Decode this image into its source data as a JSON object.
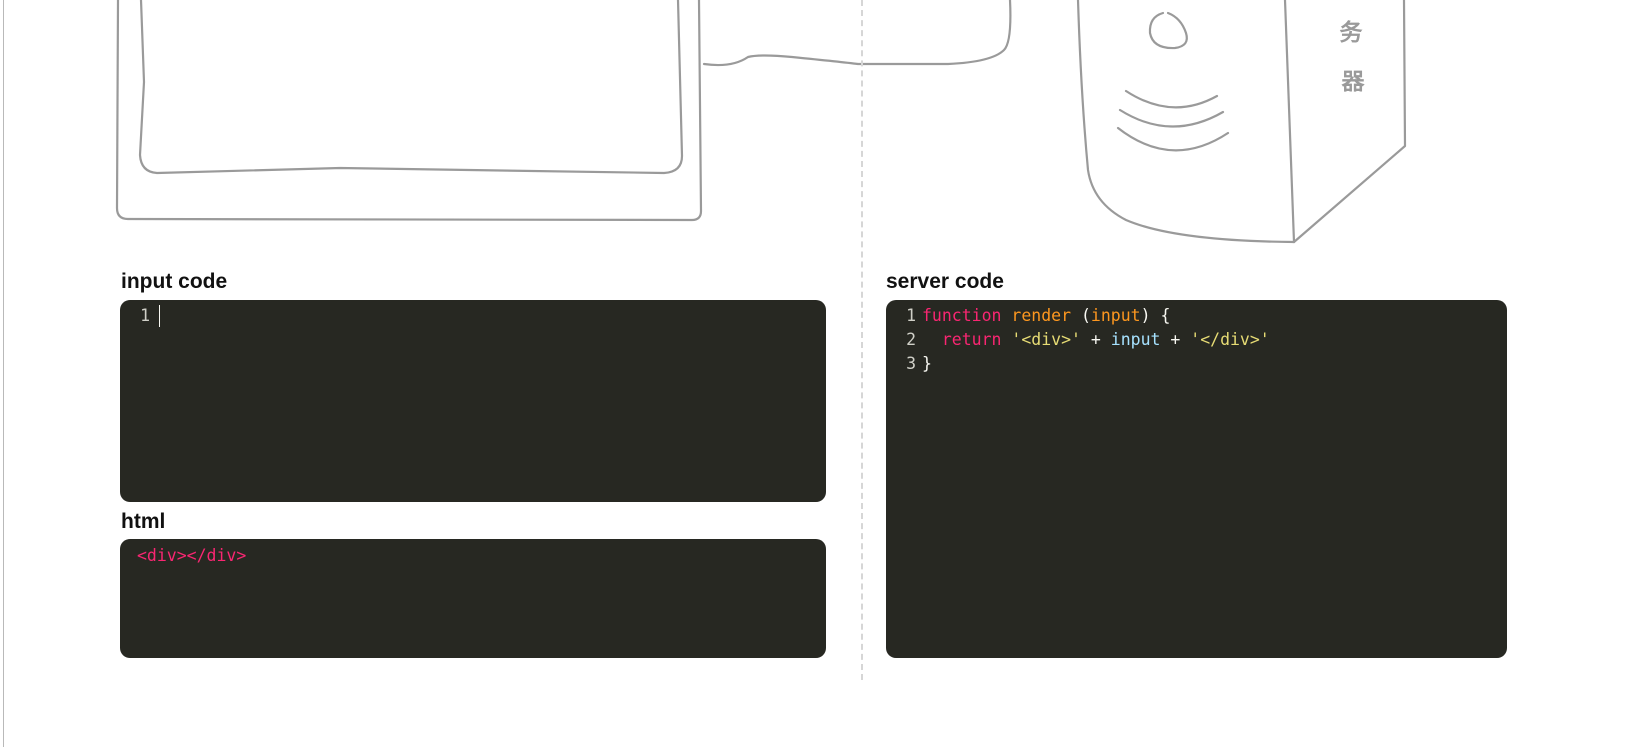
{
  "labels": {
    "input": "input code",
    "html": "html",
    "server": "server code"
  },
  "input_editor": {
    "lines": [
      {
        "num": "1",
        "text": ""
      }
    ]
  },
  "html_output": {
    "text": "<div></div>"
  },
  "server_editor": {
    "lines": [
      {
        "num": "1",
        "tokens": [
          {
            "t": "function",
            "c": "keyword"
          },
          {
            "t": " ",
            "c": "punc"
          },
          {
            "t": "render",
            "c": "fn"
          },
          {
            "t": " (",
            "c": "punc"
          },
          {
            "t": "input",
            "c": "param"
          },
          {
            "t": ") {",
            "c": "punc"
          }
        ]
      },
      {
        "num": "2",
        "tokens": [
          {
            "t": "  ",
            "c": "punc"
          },
          {
            "t": "return",
            "c": "keyword"
          },
          {
            "t": " ",
            "c": "punc"
          },
          {
            "t": "'<div>'",
            "c": "string"
          },
          {
            "t": " + ",
            "c": "punc"
          },
          {
            "t": "input",
            "c": "var"
          },
          {
            "t": " + ",
            "c": "punc"
          },
          {
            "t": "'</div>'",
            "c": "string"
          }
        ]
      },
      {
        "num": "3",
        "tokens": [
          {
            "t": "}",
            "c": "punc"
          }
        ]
      }
    ]
  },
  "colors": {
    "editor_bg": "#272822",
    "keyword": "#f92672",
    "function": "#fd971f",
    "string": "#e6db74",
    "variable": "#a6e2ff",
    "sketch_stroke": "#9a9a9a"
  },
  "illustration": {
    "server_glyphs": [
      "务",
      "器"
    ]
  }
}
